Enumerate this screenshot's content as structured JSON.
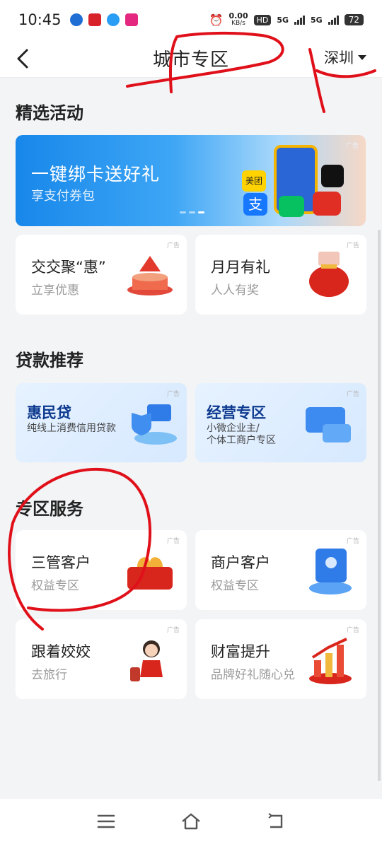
{
  "status_bar": {
    "time": "10:45",
    "speed_value": "0.00",
    "speed_unit": "KB/s",
    "hd": "HD",
    "net_a": "5G",
    "net_b": "5G",
    "battery": "72"
  },
  "header": {
    "title": "城市专区",
    "city": "深圳"
  },
  "featured": {
    "section_title": "精选活动",
    "banner": {
      "title": "一键绑卡送好礼",
      "subtitle": "享支付券包",
      "ad_tag": "广告",
      "brand_meituan": "美团",
      "brand_alipay": "支"
    },
    "cards": [
      {
        "title": "交交聚“惠”",
        "subtitle": "立享优惠",
        "ad_tag": "广告"
      },
      {
        "title": "月月有礼",
        "subtitle": "人人有奖",
        "ad_tag": "广告"
      }
    ]
  },
  "loans": {
    "section_title": "贷款推荐",
    "cards": [
      {
        "title": "惠民贷",
        "subtitle": "纯线上消费信用贷款",
        "ad_tag": "广告"
      },
      {
        "title": "经营专区",
        "subtitle_line1": "小微企业主/",
        "subtitle_line2": "个体工商户专区",
        "ad_tag": "广告"
      }
    ]
  },
  "services": {
    "section_title": "专区服务",
    "cards": [
      {
        "title": "三管客户",
        "subtitle": "权益专区",
        "ad_tag": "广告"
      },
      {
        "title": "商户客户",
        "subtitle": "权益专区",
        "ad_tag": "广告"
      },
      {
        "title": "跟着姣姣",
        "subtitle": "去旅行",
        "ad_tag": "广告"
      },
      {
        "title": "财富提升",
        "subtitle": "品牌好礼随心兑",
        "ad_tag": "广告"
      }
    ]
  },
  "colors": {
    "accent_blue": "#1787ea",
    "annotation_red": "#e0101a",
    "background": "#f3f4f6"
  },
  "icons": [
    "back-arrow-icon",
    "caret-down-icon",
    "menu-icon",
    "home-icon",
    "return-icon"
  ]
}
